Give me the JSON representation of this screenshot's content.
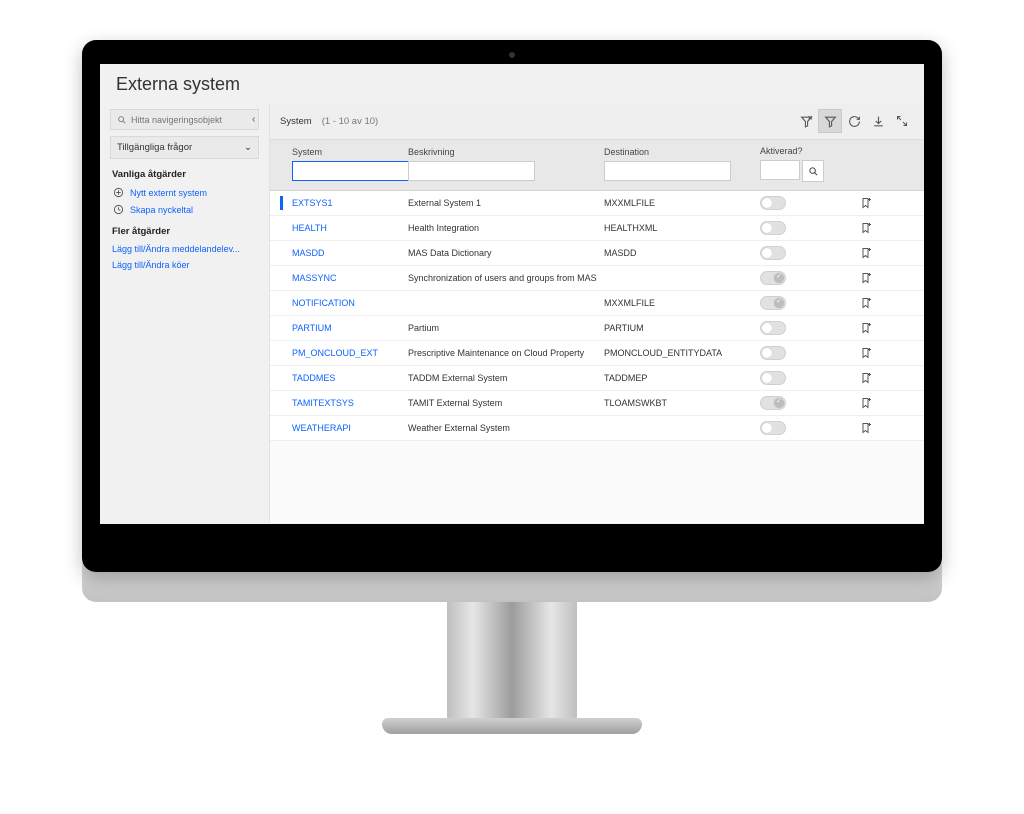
{
  "page_title": "Externa system",
  "sidebar": {
    "search_placeholder": "Hitta navigeringsobjekt",
    "queries_label": "Tillgängliga frågor",
    "common_heading": "Vanliga åtgärder",
    "common_actions": [
      {
        "icon": "plus-circle-icon",
        "label": "Nytt externt system"
      },
      {
        "icon": "clock-icon",
        "label": "Skapa nyckeltal"
      }
    ],
    "more_heading": "Fler åtgärder",
    "more_actions": [
      {
        "label": "Lägg till/Ändra meddelandelev..."
      },
      {
        "label": "Lägg till/Ändra köer"
      }
    ]
  },
  "toolbar": {
    "label": "System",
    "count": "(1 - 10 av 10)"
  },
  "columns": {
    "system": "System",
    "description": "Beskrivning",
    "destination": "Destination",
    "activated": "Aktiverad?"
  },
  "rows": [
    {
      "system": "EXTSYS1",
      "description": "External System 1",
      "destination": "MXXMLFILE",
      "active": false,
      "selected": true
    },
    {
      "system": "HEALTH",
      "description": "Health Integration",
      "destination": "HEALTHXML",
      "active": false
    },
    {
      "system": "MASDD",
      "description": "MAS Data Dictionary",
      "destination": "MASDD",
      "active": false
    },
    {
      "system": "MASSYNC",
      "description": "Synchronization of users and groups from MAS",
      "destination": "",
      "active": true
    },
    {
      "system": "NOTIFICATION",
      "description": "",
      "destination": "MXXMLFILE",
      "active": true
    },
    {
      "system": "PARTIUM",
      "description": "Partium",
      "destination": "PARTIUM",
      "active": false
    },
    {
      "system": "PM_ONCLOUD_EXT",
      "description": "Prescriptive Maintenance on Cloud Property",
      "destination": "PMONCLOUD_ENTITYDATA",
      "active": false
    },
    {
      "system": "TADDMES",
      "description": "TADDM External System",
      "destination": "TADDMEP",
      "active": false
    },
    {
      "system": "TAMITEXTSYS",
      "description": "TAMIT External System",
      "destination": "TLOAMSWKBT",
      "active": true
    },
    {
      "system": "WEATHERAPI",
      "description": "Weather External System",
      "destination": "",
      "active": false
    }
  ]
}
